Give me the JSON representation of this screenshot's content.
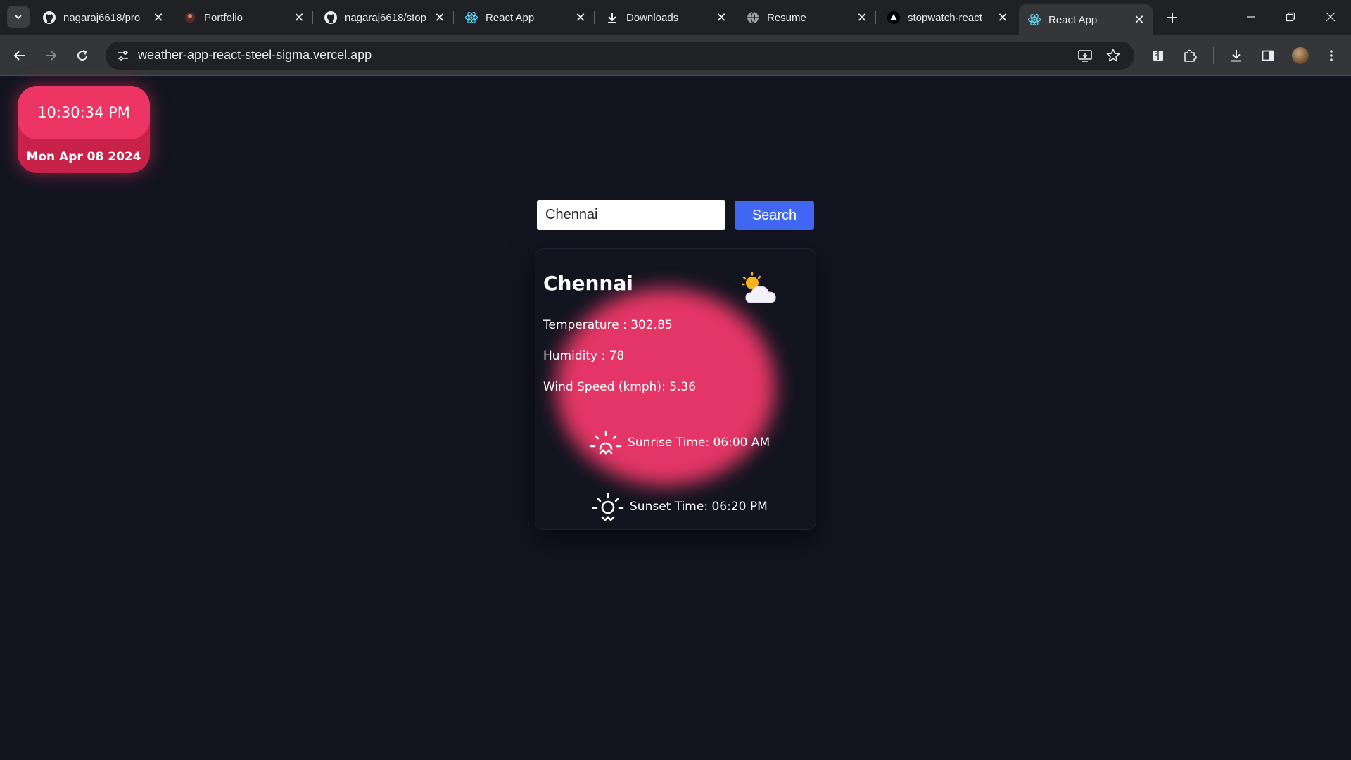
{
  "browser": {
    "tabs": [
      {
        "title": "nagaraj6618/pro",
        "icon": "github-icon",
        "active": false
      },
      {
        "title": "Portfolio",
        "icon": "portfolio-icon",
        "active": false
      },
      {
        "title": "nagaraj6618/stop",
        "icon": "github-icon",
        "active": false
      },
      {
        "title": "React App",
        "icon": "react-icon",
        "active": false
      },
      {
        "title": "Downloads",
        "icon": "download-icon",
        "active": false
      },
      {
        "title": "Resume",
        "icon": "globe-icon",
        "active": false
      },
      {
        "title": "stopwatch-react",
        "icon": "vercel-icon",
        "active": false
      },
      {
        "title": "React App",
        "icon": "react-icon",
        "active": true
      }
    ],
    "url": "weather-app-react-steel-sigma.vercel.app"
  },
  "clock": {
    "time": "10:30:34 PM",
    "date": "Mon Apr 08 2024"
  },
  "search": {
    "value": "Chennai",
    "button_label": "Search"
  },
  "weather": {
    "city": "Chennai",
    "icon": "partly-cloudy-icon",
    "temperature": "Temperature : 302.85",
    "humidity": "Humidity : 78",
    "wind": "Wind Speed (kmph): 5.36",
    "sunrise": "Sunrise Time: 06:00 AM",
    "sunset": "Sunset Time: 06:20 PM"
  },
  "colors": {
    "page_bg": "#121420",
    "accent_pink": "#ec3564",
    "search_blue": "#3f67f3"
  }
}
